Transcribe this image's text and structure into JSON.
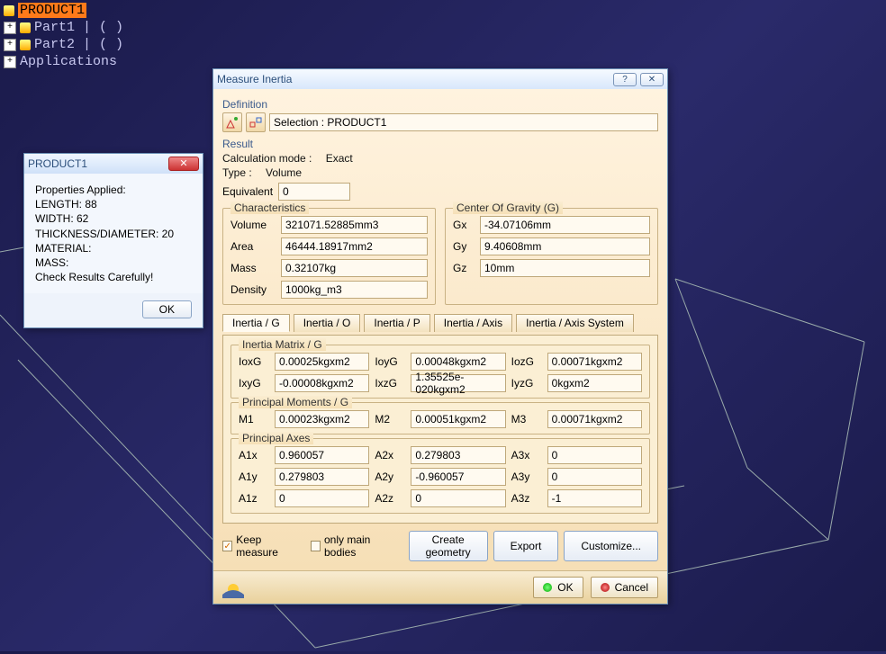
{
  "tree": {
    "items": [
      {
        "label": "PRODUCT1",
        "selected": true
      },
      {
        "label": "Part1 | ( )"
      },
      {
        "label": "Part2 | ( )"
      },
      {
        "label": "Applications"
      }
    ]
  },
  "small_dialog": {
    "title": "PRODUCT1",
    "lines": [
      "Properties Applied:",
      "LENGTH: 88",
      "WIDTH: 62",
      "THICKNESS/DIAMETER: 20",
      "MATERIAL:",
      "MASS:",
      "Check Results Carefully!"
    ],
    "ok": "OK"
  },
  "dialog": {
    "title": "Measure Inertia",
    "def_head": "Definition",
    "selection_label": "Selection : PRODUCT1",
    "result_head": "Result",
    "calc_mode_label": "Calculation mode :",
    "calc_mode_value": "Exact",
    "type_label": "Type :",
    "type_value": "Volume",
    "equivalent_label": "Equivalent",
    "equivalent_value": "0",
    "characteristics_head": "Characteristics",
    "vol_label": "Volume",
    "vol_value": "321071.52885mm3",
    "area_label": "Area",
    "area_value": "46444.18917mm2",
    "mass_label": "Mass",
    "mass_value": "0.32107kg",
    "density_label": "Density",
    "density_value": "1000kg_m3",
    "cog_head": "Center Of Gravity (G)",
    "gx_label": "Gx",
    "gx_value": "-34.07106mm",
    "gy_label": "Gy",
    "gy_value": "9.40608mm",
    "gz_label": "Gz",
    "gz_value": "10mm",
    "tabs": [
      "Inertia / G",
      "Inertia / O",
      "Inertia / P",
      "Inertia / Axis",
      "Inertia / Axis System"
    ],
    "matrix_head": "Inertia Matrix / G",
    "ioxg_l": "IoxG",
    "ioxg_v": "0.00025kgxm2",
    "ioyg_l": "IoyG",
    "ioyg_v": "0.00048kgxm2",
    "iozg_l": "IozG",
    "iozg_v": "0.00071kgxm2",
    "ixyg_l": "IxyG",
    "ixyg_v": "-0.00008kgxm2",
    "ixzg_l": "IxzG",
    "ixzg_v": "1.35525e-020kgxm2",
    "iyzg_l": "IyzG",
    "iyzg_v": "0kgxm2",
    "pmom_head": "Principal Moments / G",
    "m1_l": "M1",
    "m1_v": "0.00023kgxm2",
    "m2_l": "M2",
    "m2_v": "0.00051kgxm2",
    "m3_l": "M3",
    "m3_v": "0.00071kgxm2",
    "paxes_head": "Principal Axes",
    "a1x_l": "A1x",
    "a1x_v": "0.960057",
    "a2x_l": "A2x",
    "a2x_v": "0.279803",
    "a3x_l": "A3x",
    "a3x_v": "0",
    "a1y_l": "A1y",
    "a1y_v": "0.279803",
    "a2y_l": "A2y",
    "a2y_v": "-0.960057",
    "a3y_l": "A3y",
    "a3y_v": "0",
    "a1z_l": "A1z",
    "a1z_v": "0",
    "a2z_l": "A2z",
    "a2z_v": "0",
    "a3z_l": "A3z",
    "a3z_v": "-1",
    "keep_measure": "Keep measure",
    "only_main": "only main bodies",
    "create_geo": "Create geometry",
    "export": "Export",
    "customize": "Customize...",
    "ok": "OK",
    "cancel": "Cancel"
  }
}
